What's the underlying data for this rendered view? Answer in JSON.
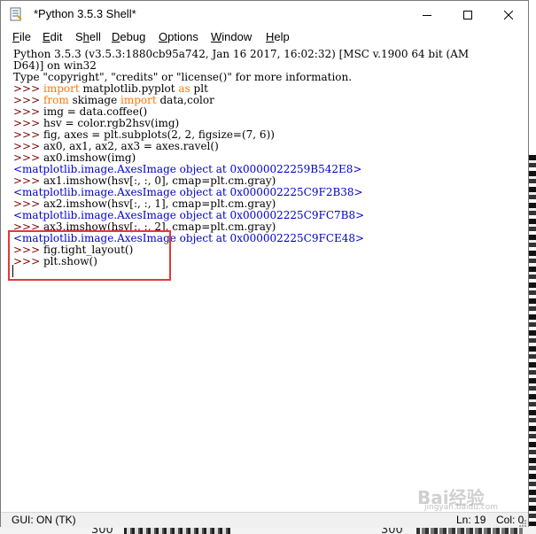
{
  "window": {
    "title": "*Python 3.5.3 Shell*"
  },
  "menu": {
    "items": [
      "File",
      "Edit",
      "Shell",
      "Debug",
      "Options",
      "Window",
      "Help"
    ]
  },
  "shell": {
    "banner_1": "Python 3.5.3 (v3.5.3:1880cb95a742, Jan 16 2017, 16:02:32) [MSC v.1900 64 bit (AM",
    "banner_2": "D64)] on win32",
    "banner_3": "Type \"copyright\", \"credits\" or \"license()\" for more information.",
    "prompt": ">>> ",
    "cmd_1_kw1": "import",
    "cmd_1_rest1": " matplotlib.pyplot ",
    "cmd_1_kw2": "as",
    "cmd_1_rest2": " plt",
    "cmd_2_kw1": "from",
    "cmd_2_rest1": " skimage ",
    "cmd_2_kw2": "import",
    "cmd_2_rest2": " data,color",
    "cmd_3": "img = data.coffee()",
    "cmd_4": "hsv = color.rgb2hsv(img)",
    "cmd_5": "fig, axes = plt.subplots(2, 2, figsize=(7, 6))",
    "cmd_6": "ax0, ax1, ax2, ax3 = axes.ravel()",
    "cmd_7": "ax0.imshow(img)",
    "out_1": "<matplotlib.image.AxesImage object at 0x0000022259B542E8>",
    "cmd_8": "ax1.imshow(hsv[:, :, 0], cmap=plt.cm.gray)",
    "out_2": "<matplotlib.image.AxesImage object at 0x000002225C9F2B38>",
    "cmd_9": "ax2.imshow(hsv[:, :, 1], cmap=plt.cm.gray)",
    "out_3": "<matplotlib.image.AxesImage object at 0x000002225C9FC7B8>",
    "cmd_10": "ax3.imshow(hsv[:, :, 2], cmap=plt.cm.gray)",
    "out_4": "<matplotlib.image.AxesImage object at 0x000002225C9FCE48>",
    "cmd_11": "fig.tight_layout()",
    "cmd_12": "plt.show()"
  },
  "status": {
    "gui": "GUI: ON (TK)",
    "ln": "Ln: 19",
    "col": "Col: 0"
  },
  "background": {
    "tick_1": "300",
    "tick_2": "300"
  },
  "watermark": {
    "text": "Bai经验",
    "sub": "jingyan.baidu.com"
  },
  "colors": {
    "keyword": "#ff7700",
    "prompt": "#770000",
    "output": "#0000cc",
    "highlight_box": "#e53935"
  }
}
